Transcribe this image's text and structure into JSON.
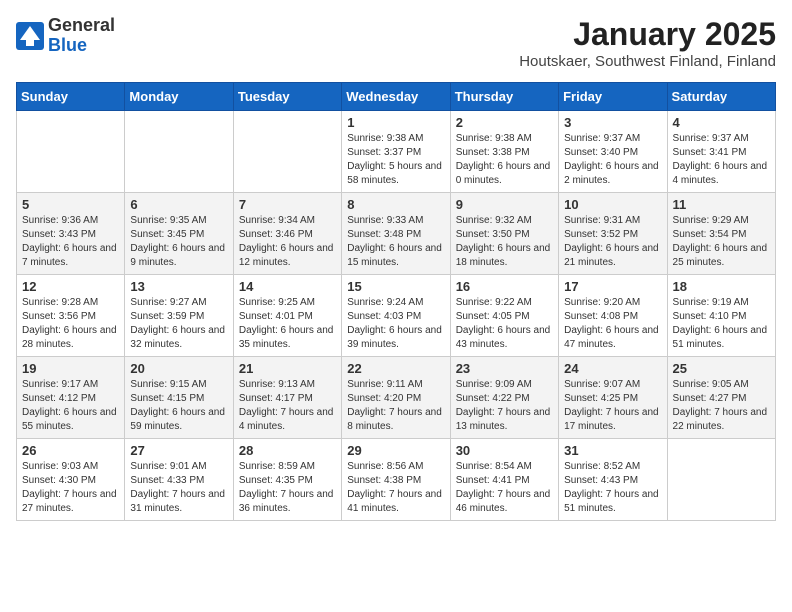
{
  "logo": {
    "general": "General",
    "blue": "Blue"
  },
  "title": "January 2025",
  "location": "Houtskaer, Southwest Finland, Finland",
  "weekdays": [
    "Sunday",
    "Monday",
    "Tuesday",
    "Wednesday",
    "Thursday",
    "Friday",
    "Saturday"
  ],
  "weeks": [
    [
      {
        "day": "",
        "info": ""
      },
      {
        "day": "",
        "info": ""
      },
      {
        "day": "",
        "info": ""
      },
      {
        "day": "1",
        "info": "Sunrise: 9:38 AM\nSunset: 3:37 PM\nDaylight: 5 hours and 58 minutes."
      },
      {
        "day": "2",
        "info": "Sunrise: 9:38 AM\nSunset: 3:38 PM\nDaylight: 6 hours and 0 minutes."
      },
      {
        "day": "3",
        "info": "Sunrise: 9:37 AM\nSunset: 3:40 PM\nDaylight: 6 hours and 2 minutes."
      },
      {
        "day": "4",
        "info": "Sunrise: 9:37 AM\nSunset: 3:41 PM\nDaylight: 6 hours and 4 minutes."
      }
    ],
    [
      {
        "day": "5",
        "info": "Sunrise: 9:36 AM\nSunset: 3:43 PM\nDaylight: 6 hours and 7 minutes."
      },
      {
        "day": "6",
        "info": "Sunrise: 9:35 AM\nSunset: 3:45 PM\nDaylight: 6 hours and 9 minutes."
      },
      {
        "day": "7",
        "info": "Sunrise: 9:34 AM\nSunset: 3:46 PM\nDaylight: 6 hours and 12 minutes."
      },
      {
        "day": "8",
        "info": "Sunrise: 9:33 AM\nSunset: 3:48 PM\nDaylight: 6 hours and 15 minutes."
      },
      {
        "day": "9",
        "info": "Sunrise: 9:32 AM\nSunset: 3:50 PM\nDaylight: 6 hours and 18 minutes."
      },
      {
        "day": "10",
        "info": "Sunrise: 9:31 AM\nSunset: 3:52 PM\nDaylight: 6 hours and 21 minutes."
      },
      {
        "day": "11",
        "info": "Sunrise: 9:29 AM\nSunset: 3:54 PM\nDaylight: 6 hours and 25 minutes."
      }
    ],
    [
      {
        "day": "12",
        "info": "Sunrise: 9:28 AM\nSunset: 3:56 PM\nDaylight: 6 hours and 28 minutes."
      },
      {
        "day": "13",
        "info": "Sunrise: 9:27 AM\nSunset: 3:59 PM\nDaylight: 6 hours and 32 minutes."
      },
      {
        "day": "14",
        "info": "Sunrise: 9:25 AM\nSunset: 4:01 PM\nDaylight: 6 hours and 35 minutes."
      },
      {
        "day": "15",
        "info": "Sunrise: 9:24 AM\nSunset: 4:03 PM\nDaylight: 6 hours and 39 minutes."
      },
      {
        "day": "16",
        "info": "Sunrise: 9:22 AM\nSunset: 4:05 PM\nDaylight: 6 hours and 43 minutes."
      },
      {
        "day": "17",
        "info": "Sunrise: 9:20 AM\nSunset: 4:08 PM\nDaylight: 6 hours and 47 minutes."
      },
      {
        "day": "18",
        "info": "Sunrise: 9:19 AM\nSunset: 4:10 PM\nDaylight: 6 hours and 51 minutes."
      }
    ],
    [
      {
        "day": "19",
        "info": "Sunrise: 9:17 AM\nSunset: 4:12 PM\nDaylight: 6 hours and 55 minutes."
      },
      {
        "day": "20",
        "info": "Sunrise: 9:15 AM\nSunset: 4:15 PM\nDaylight: 6 hours and 59 minutes."
      },
      {
        "day": "21",
        "info": "Sunrise: 9:13 AM\nSunset: 4:17 PM\nDaylight: 7 hours and 4 minutes."
      },
      {
        "day": "22",
        "info": "Sunrise: 9:11 AM\nSunset: 4:20 PM\nDaylight: 7 hours and 8 minutes."
      },
      {
        "day": "23",
        "info": "Sunrise: 9:09 AM\nSunset: 4:22 PM\nDaylight: 7 hours and 13 minutes."
      },
      {
        "day": "24",
        "info": "Sunrise: 9:07 AM\nSunset: 4:25 PM\nDaylight: 7 hours and 17 minutes."
      },
      {
        "day": "25",
        "info": "Sunrise: 9:05 AM\nSunset: 4:27 PM\nDaylight: 7 hours and 22 minutes."
      }
    ],
    [
      {
        "day": "26",
        "info": "Sunrise: 9:03 AM\nSunset: 4:30 PM\nDaylight: 7 hours and 27 minutes."
      },
      {
        "day": "27",
        "info": "Sunrise: 9:01 AM\nSunset: 4:33 PM\nDaylight: 7 hours and 31 minutes."
      },
      {
        "day": "28",
        "info": "Sunrise: 8:59 AM\nSunset: 4:35 PM\nDaylight: 7 hours and 36 minutes."
      },
      {
        "day": "29",
        "info": "Sunrise: 8:56 AM\nSunset: 4:38 PM\nDaylight: 7 hours and 41 minutes."
      },
      {
        "day": "30",
        "info": "Sunrise: 8:54 AM\nSunset: 4:41 PM\nDaylight: 7 hours and 46 minutes."
      },
      {
        "day": "31",
        "info": "Sunrise: 8:52 AM\nSunset: 4:43 PM\nDaylight: 7 hours and 51 minutes."
      },
      {
        "day": "",
        "info": ""
      }
    ]
  ]
}
